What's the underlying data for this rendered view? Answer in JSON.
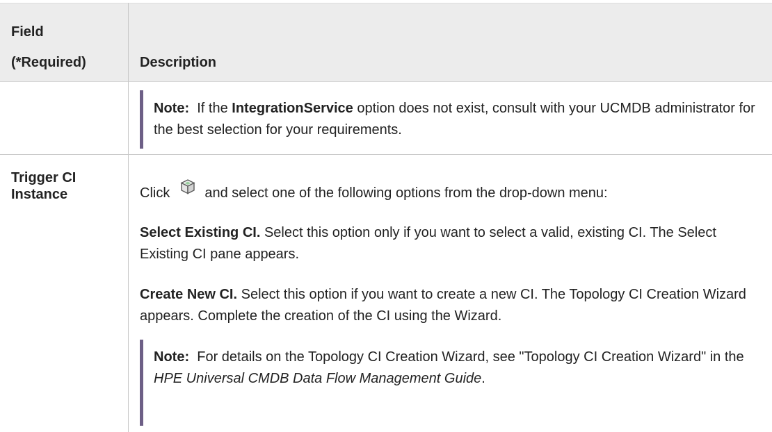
{
  "header": {
    "field_line1": "Field",
    "field_line2": "(*Required)",
    "description": "Description"
  },
  "row1": {
    "note_label": "Note:",
    "note_text_before": "If the",
    "note_bold": "IntegrationService",
    "note_text_after": "option does not exist, consult with your UCMDB administrator for the best selection for your requirements."
  },
  "row2": {
    "field_line1": "Trigger CI",
    "field_line2": "Instance",
    "click_word": "Click",
    "click_rest": "and select one of the following options from the drop-down menu:",
    "icon": "ci-cube-icon",
    "opt1_label": "Select Existing CI.",
    "opt1_text": "Select this option only if you want to select a valid, existing CI. The Select Existing CI pane appears.",
    "opt2_label": "Create New CI.",
    "opt2_text": "Select this option if you want to create a new CI. The Topology CI Creation Wizard appears. Complete the creation of the CI using the Wizard.",
    "note_label": "Note:",
    "note_text_before": "For details on the Topology CI Creation Wizard, see \"Topology CI Creation Wizard\" in the",
    "note_italic": "HPE Universal CMDB Data Flow Management Guide",
    "note_text_after": "."
  },
  "colors": {
    "header_bg": "#ececec",
    "note_bar": "#6d5f86",
    "grid": "#c8c8c8"
  }
}
